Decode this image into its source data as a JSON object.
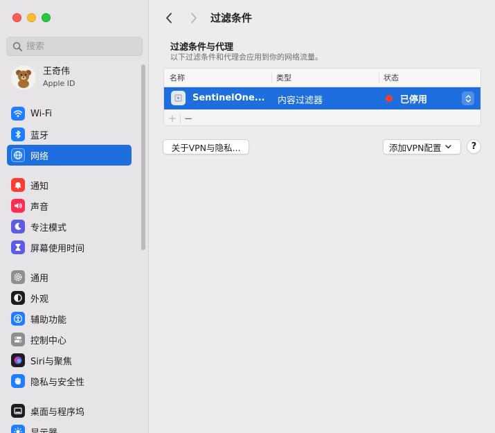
{
  "sidebar": {
    "search_placeholder": "搜索",
    "account": {
      "name": "王奇伟",
      "subtitle": "Apple ID"
    },
    "groups": [
      [
        {
          "label": "Wi-Fi",
          "icon": "wifi-icon",
          "color": "#1f7dff"
        },
        {
          "label": "蓝牙",
          "icon": "bluetooth-icon",
          "color": "#1f7dff"
        },
        {
          "label": "网络",
          "icon": "globe-icon",
          "color": "#1f7dff",
          "active": true
        }
      ],
      [
        {
          "label": "通知",
          "icon": "bell-icon",
          "color": "#ff3b30"
        },
        {
          "label": "声音",
          "icon": "speaker-icon",
          "color": "#ff2d55"
        },
        {
          "label": "专注模式",
          "icon": "moon-icon",
          "color": "#5e5ce6"
        },
        {
          "label": "屏幕使用时间",
          "icon": "hourglass-icon",
          "color": "#5e5ce6"
        }
      ],
      [
        {
          "label": "通用",
          "icon": "gear-icon",
          "color": "#8e8e93"
        },
        {
          "label": "外观",
          "icon": "appearance-icon",
          "color": "#1d1d1f"
        },
        {
          "label": "辅助功能",
          "icon": "accessibility-icon",
          "color": "#1f7dff"
        },
        {
          "label": "控制中心",
          "icon": "toggles-icon",
          "color": "#8e8e93"
        },
        {
          "label": "Siri与聚焦",
          "icon": "siri-icon",
          "color": "#8a3ffc"
        },
        {
          "label": "隐私与安全性",
          "icon": "hand-icon",
          "color": "#1f7dff"
        }
      ],
      [
        {
          "label": "桌面与程序坞",
          "icon": "dock-icon",
          "color": "#1d1d1f"
        },
        {
          "label": "显示器",
          "icon": "display-icon",
          "color": "#1f7dff"
        }
      ]
    ]
  },
  "toolbar": {
    "title": "过滤条件"
  },
  "section": {
    "title": "过滤条件与代理",
    "subtitle": "以下过滤条件和代理会应用到你的网络流量。"
  },
  "table": {
    "headers": [
      "名称",
      "类型",
      "状态"
    ],
    "rows": [
      {
        "name": "SentinelOne...",
        "type": "内容过滤器",
        "status": "已停用",
        "status_color": "#ff3b30"
      }
    ],
    "add_label": "+",
    "remove_label": "−"
  },
  "buttons": {
    "about_vpn": "关于VPN与隐私...",
    "add_vpn": "添加VPN配置",
    "help": "?"
  },
  "colors": {
    "accent": "#1e6fdd"
  }
}
